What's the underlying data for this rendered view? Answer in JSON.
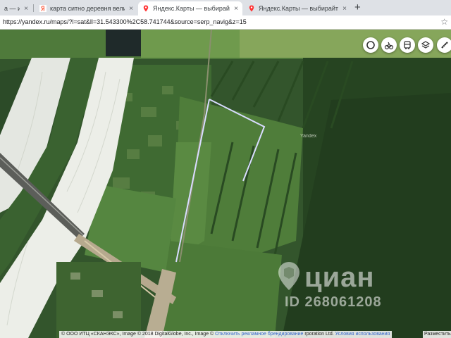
{
  "tabs": [
    {
      "title": "а — иль",
      "favicon": "yandex-favicon",
      "active": false
    },
    {
      "title": "карта ситно деревня великий н",
      "favicon": "yandex-favicon",
      "active": false
    },
    {
      "title": "Яндекс.Карты — выбирайте, гд",
      "favicon": "yandex-maps-pin-favicon",
      "active": true
    },
    {
      "title": "Яндекс.Карты — выбирайте, гд",
      "favicon": "yandex-maps-pin-favicon",
      "active": false
    }
  ],
  "close_glyph": "×",
  "new_tab_glyph": "+",
  "address_bar": {
    "url": "https://yandex.ru/maps/?l=sat&ll=31.543300%2C58.741744&source=serp_navig&z=15"
  },
  "map": {
    "controls": [
      {
        "name": "layers-circle-icon"
      },
      {
        "name": "bicycle-icon"
      },
      {
        "name": "bus-icon"
      },
      {
        "name": "layers-icon"
      },
      {
        "name": "ruler-icon"
      }
    ],
    "road_label": "Yandex",
    "watermark": {
      "brand": "циан",
      "id": "ID 268061208"
    },
    "copyright": {
      "text": "© ООО ИТЦ «СКАНЭКС», Image © 2018 DigitalGlobe, Inc., Image ©",
      "link": "Отключить рекламное брендирование",
      "suffix": "rporation Ltd.",
      "terms": "Условия использования"
    },
    "scale_text": "Разместить"
  },
  "colors": {
    "tab_bar": "#dee1e6",
    "active_tab": "#ffffff",
    "plot_outline": "#d9dcff",
    "river_ice": "#e9ece6",
    "forest": "#2a4a24"
  }
}
